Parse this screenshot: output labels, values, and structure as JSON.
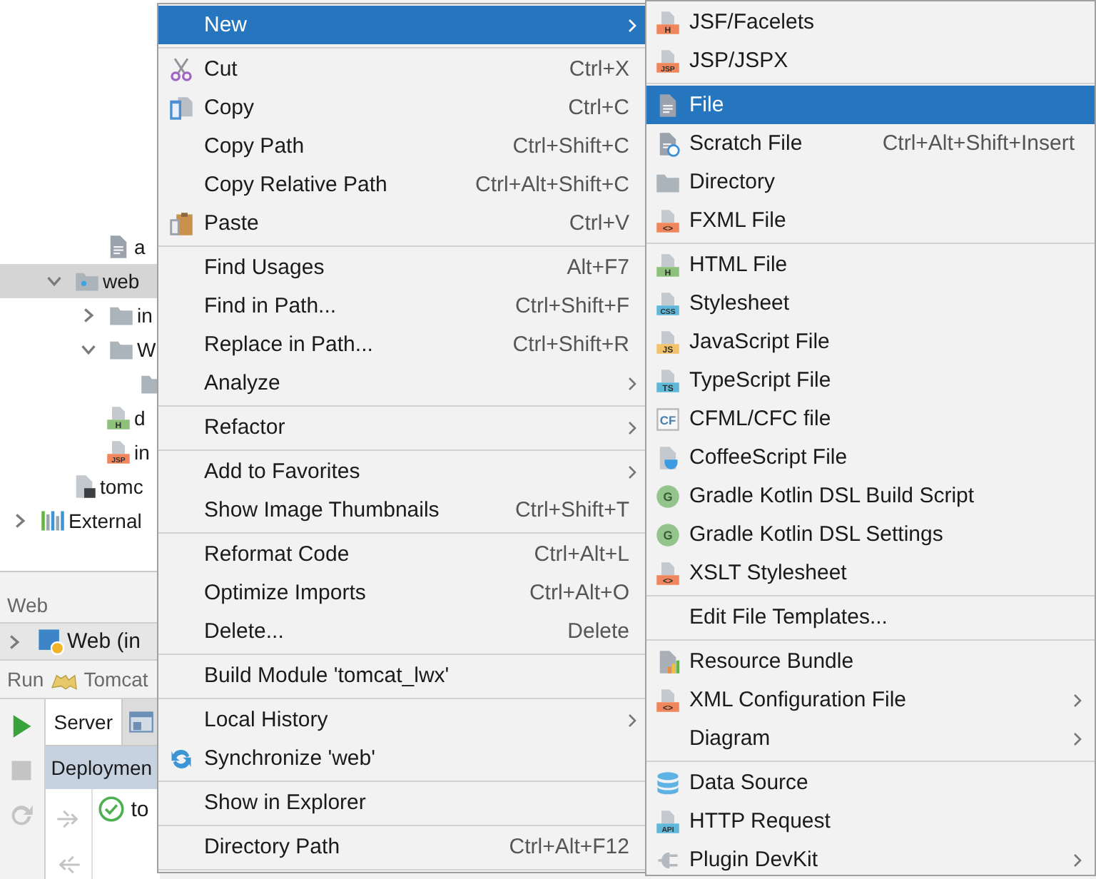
{
  "project_tree": [
    {
      "kind": "group",
      "children": [
        {
          "kind": "group",
          "children": [
            {
              "label": "a",
              "kind": "doc",
              "selected": false
            }
          ]
        },
        {
          "label": "web",
          "kind": "web_folder",
          "expanded": true,
          "selected": true,
          "children": [
            {
              "label": "in",
              "kind": "folder",
              "expanded": false,
              "selected": false
            },
            {
              "label": "W",
              "kind": "folder",
              "expanded": true,
              "selected": false,
              "children": [
                {
                  "kind": "folder",
                  "selected": false
                }
              ]
            },
            {
              "label": "d",
              "kind": "file",
              "selected": false,
              "tag": {
                "text": "H",
                "color": "#8dc07a"
              }
            },
            {
              "label": "in",
              "kind": "file",
              "selected": false,
              "tag": {
                "text": "JSP",
                "color": "#f0865c"
              }
            }
          ]
        },
        {
          "label": "tomc",
          "kind": "module_file",
          "selected": false
        }
      ]
    },
    {
      "label": "External",
      "kind": "library",
      "expanded": false,
      "selected": false
    }
  ],
  "web_panel": {
    "title": "Web",
    "rows": [
      {
        "label": "Web (in",
        "expanded": false
      }
    ]
  },
  "run_panel": {
    "title": "Run",
    "config": "Tomcat",
    "toolbar": [
      {
        "kind": "run",
        "disabled": false
      },
      {
        "kind": "stop",
        "disabled": true
      },
      {
        "kind": "rerun",
        "disabled": true
      }
    ],
    "tabs": [
      {
        "kind": "text",
        "label": "Server",
        "selected": true
      },
      {
        "kind": "icon",
        "selected": false
      }
    ],
    "deployment_header": "Deploymen",
    "deploy_tools": [
      {
        "kind": "deploy",
        "disabled": true
      },
      {
        "kind": "undeploy",
        "disabled": true
      }
    ],
    "deployments": [
      {
        "label": "to",
        "kind": "deployed"
      }
    ]
  },
  "context_menu": [
    {
      "kind": "plain",
      "label": "New",
      "submenu": true,
      "selected": true
    },
    {
      "kind": "separator"
    },
    {
      "kind": "scissors",
      "label": "Cut",
      "shortcut": "Ctrl+X",
      "selected": false
    },
    {
      "kind": "copy",
      "label": "Copy",
      "shortcut": "Ctrl+C",
      "selected": false
    },
    {
      "kind": "plain",
      "label": "Copy Path",
      "shortcut": "Ctrl+Shift+C",
      "selected": false
    },
    {
      "kind": "plain",
      "label": "Copy Relative Path",
      "shortcut": "Ctrl+Alt+Shift+C",
      "selected": false
    },
    {
      "kind": "paste",
      "label": "Paste",
      "shortcut": "Ctrl+V",
      "selected": false
    },
    {
      "kind": "separator"
    },
    {
      "kind": "plain",
      "label": "Find Usages",
      "shortcut": "Alt+F7",
      "selected": false
    },
    {
      "kind": "plain",
      "label": "Find in Path...",
      "shortcut": "Ctrl+Shift+F",
      "selected": false
    },
    {
      "kind": "plain",
      "label": "Replace in Path...",
      "shortcut": "Ctrl+Shift+R",
      "selected": false
    },
    {
      "kind": "plain",
      "label": "Analyze",
      "submenu": true,
      "selected": false
    },
    {
      "kind": "separator"
    },
    {
      "kind": "plain",
      "label": "Refactor",
      "submenu": true,
      "selected": false
    },
    {
      "kind": "separator"
    },
    {
      "kind": "plain",
      "label": "Add to Favorites",
      "submenu": true,
      "selected": false
    },
    {
      "kind": "plain",
      "label": "Show Image Thumbnails",
      "shortcut": "Ctrl+Shift+T",
      "selected": false
    },
    {
      "kind": "separator"
    },
    {
      "kind": "plain",
      "label": "Reformat Code",
      "shortcut": "Ctrl+Alt+L",
      "selected": false
    },
    {
      "kind": "plain",
      "label": "Optimize Imports",
      "shortcut": "Ctrl+Alt+O",
      "selected": false
    },
    {
      "kind": "plain",
      "label": "Delete...",
      "shortcut": "Delete",
      "selected": false
    },
    {
      "kind": "separator"
    },
    {
      "kind": "plain",
      "label": "Build Module 'tomcat_lwx'",
      "selected": false
    },
    {
      "kind": "separator"
    },
    {
      "kind": "plain",
      "label": "Local History",
      "submenu": true,
      "selected": false
    },
    {
      "kind": "sync",
      "label": "Synchronize 'web'",
      "selected": false
    },
    {
      "kind": "separator"
    },
    {
      "kind": "plain",
      "label": "Show in Explorer",
      "selected": false
    },
    {
      "kind": "separator"
    },
    {
      "kind": "plain",
      "label": "Directory Path",
      "shortcut": "Ctrl+Alt+F12",
      "selected": false
    },
    {
      "kind": "separator"
    }
  ],
  "new_submenu": [
    {
      "kind": "file",
      "label": "JSF/Facelets",
      "tag": {
        "text": "H",
        "color": "#f0865c"
      },
      "selected": false
    },
    {
      "kind": "file",
      "label": "JSP/JSPX",
      "tag": {
        "text": "JSP",
        "color": "#f0865c"
      },
      "selected": false
    },
    {
      "kind": "separator"
    },
    {
      "kind": "doc",
      "label": "File",
      "selected": true
    },
    {
      "kind": "scratch",
      "label": "Scratch File",
      "shortcut": "Ctrl+Alt+Shift+Insert",
      "selected": false
    },
    {
      "kind": "folder",
      "label": "Directory",
      "selected": false
    },
    {
      "kind": "file",
      "label": "FXML File",
      "tag": {
        "text": "<>",
        "color": "#f0865c"
      },
      "selected": false
    },
    {
      "kind": "separator"
    },
    {
      "kind": "file",
      "label": "HTML File",
      "tag": {
        "text": "H",
        "color": "#8dc07a"
      },
      "selected": false
    },
    {
      "kind": "file",
      "label": "Stylesheet",
      "tag": {
        "text": "CSS",
        "color": "#5fb8d9"
      },
      "selected": false
    },
    {
      "kind": "file",
      "label": "JavaScript File",
      "tag": {
        "text": "JS",
        "color": "#f3c26b"
      },
      "selected": false
    },
    {
      "kind": "file",
      "label": "TypeScript File",
      "tag": {
        "text": "TS",
        "color": "#5fb8d9"
      },
      "selected": false
    },
    {
      "kind": "cf",
      "label": "CFML/CFC file",
      "tag": {
        "text": "CF",
        "color": "#4a7fae"
      },
      "selected": false
    },
    {
      "kind": "coffee",
      "label": "CoffeeScript File",
      "selected": false
    },
    {
      "kind": "gradle",
      "label": "Gradle Kotlin DSL Build Script",
      "tag": {
        "text": "G",
        "color": "#93c48b"
      },
      "selected": false
    },
    {
      "kind": "gradle",
      "label": "Gradle Kotlin DSL Settings",
      "tag": {
        "text": "G",
        "color": "#93c48b"
      },
      "selected": false
    },
    {
      "kind": "file",
      "label": "XSLT Stylesheet",
      "tag": {
        "text": "<>",
        "color": "#f0865c"
      },
      "selected": false
    },
    {
      "kind": "separator"
    },
    {
      "kind": "plain",
      "label": "Edit File Templates...",
      "selected": false
    },
    {
      "kind": "separator"
    },
    {
      "kind": "bundle",
      "label": "Resource Bundle",
      "selected": false
    },
    {
      "kind": "file",
      "label": "XML Configuration File",
      "tag": {
        "text": "<>",
        "color": "#f0865c"
      },
      "submenu": true,
      "selected": false
    },
    {
      "kind": "plain",
      "label": "Diagram",
      "submenu": true,
      "selected": false
    },
    {
      "kind": "separator"
    },
    {
      "kind": "database",
      "label": "Data Source",
      "selected": false
    },
    {
      "kind": "file",
      "label": "HTTP Request",
      "tag": {
        "text": "API",
        "color": "#5fb8d9"
      },
      "selected": false
    },
    {
      "kind": "plugin",
      "label": "Plugin DevKit",
      "submenu": true,
      "selected": false
    }
  ]
}
